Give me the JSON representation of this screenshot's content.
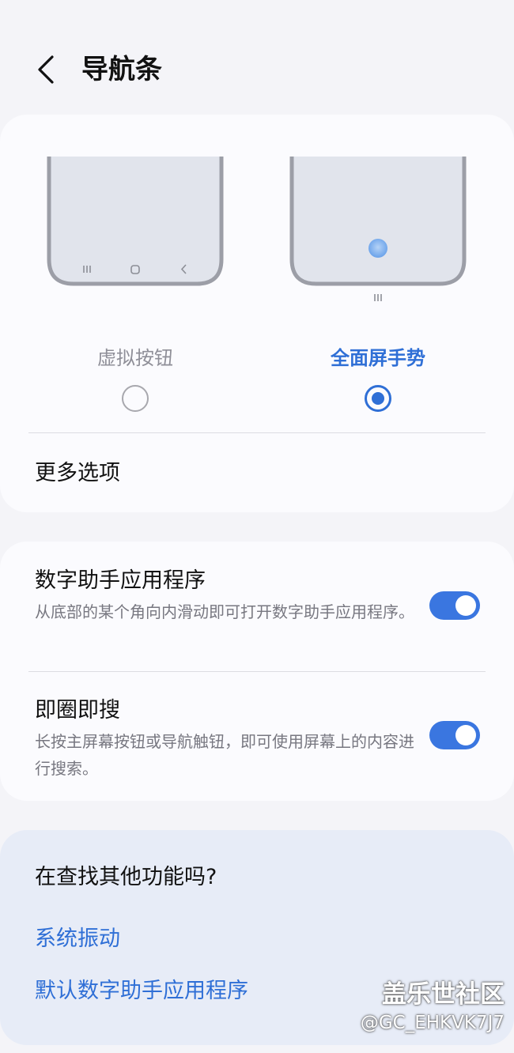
{
  "header": {
    "title": "导航条"
  },
  "navigation_type": {
    "options": [
      {
        "label": "虚拟按钮",
        "selected": false
      },
      {
        "label": "全面屏手势",
        "selected": true
      }
    ],
    "more_options_label": "更多选项"
  },
  "settings": [
    {
      "title": "数字助手应用程序",
      "description": "从底部的某个角向内滑动即可打开数字助手应用程序。",
      "enabled": true
    },
    {
      "title": "即圈即搜",
      "description": "长按主屏幕按钮或导航触钮，即可使用屏幕上的内容进行搜索。",
      "enabled": true
    }
  ],
  "looking_for": {
    "title": "在查找其他功能吗?",
    "links": [
      "系统振动",
      "默认数字助手应用程序"
    ]
  },
  "watermark": {
    "site": "盖乐世社区",
    "user": "@GC_EHKVK7J7"
  },
  "colors": {
    "accent": "#2f6fd6",
    "toggle_on": "#3a76e0",
    "background": "#f4f4f8",
    "card": "#fbfbfe",
    "suggestion_card": "#e7ecf7"
  }
}
